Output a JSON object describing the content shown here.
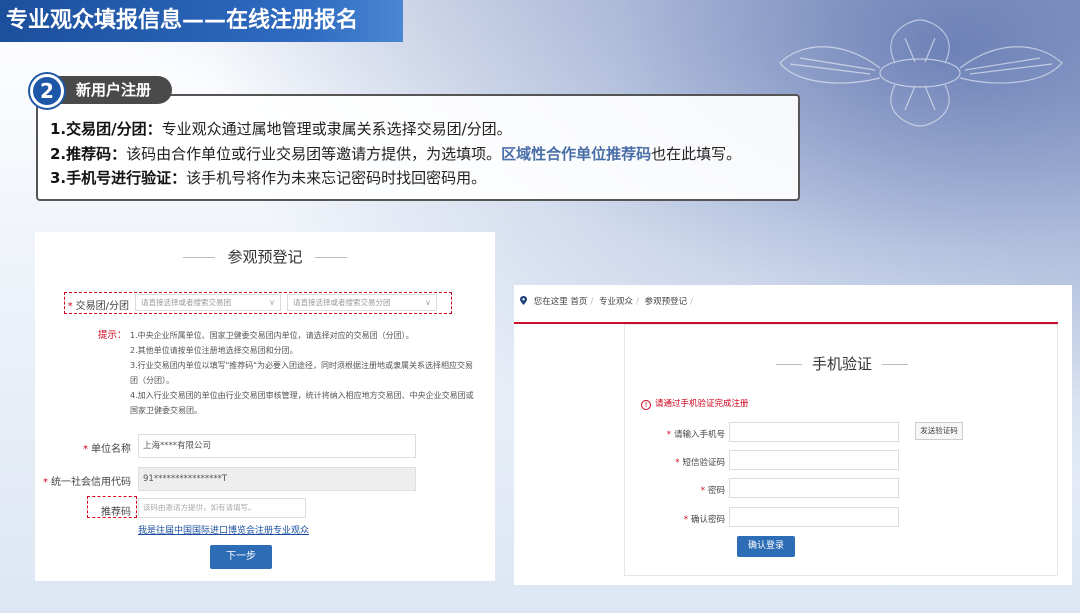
{
  "banner": {
    "title": "专业观众填报信息——在线注册报名"
  },
  "step": {
    "number": "2",
    "title": "新用户注册",
    "lines": [
      {
        "bold": "1.交易团/分团：",
        "text": "专业观众通过属地管理或隶属关系选择交易团/分团。"
      },
      {
        "bold": "2.推荐码：",
        "text": "该码由合作单位或行业交易团等邀请方提供，为选填项。",
        "highlight": "区域性合作单位推荐码",
        "tail": "也在此填写。"
      },
      {
        "bold": "3.手机号进行验证：",
        "text": "该手机号将作为未来忘记密码时找回密码用。"
      }
    ]
  },
  "registration": {
    "title": "参观预登记",
    "group_label": "交易团/分团",
    "group_placeholder": "请直接选择或者搜索交易团",
    "subgroup_placeholder": "请直接选择或者搜索交易分团",
    "tips_label": "提示：",
    "tips": [
      "1.中央企业所属单位、国家卫健委交易团内单位，请选择对应的交易团（分团）。",
      "2.其他单位请按单位注册地选择交易团和分团。",
      "3.行业交易团内单位以填写\"推荐码\"为必要入团途径，同时须根据注册地或隶属关系选择相应交易团（分团）。",
      "4.加入行业交易团的单位由行业交易团审核管理，统计将纳入相应地方交易团、中央企业交易团或国家卫健委交易团。"
    ],
    "company_label": "单位名称",
    "company_value": "上海****有限公司",
    "credit_label": "统一社会信用代码",
    "credit_value": "91****************T",
    "referral_label": "推荐码",
    "referral_placeholder": "该码由邀请方提供，如有请填写。",
    "past_link": "我是往届中国国际进口博览会注册专业观众",
    "next_button": "下一步"
  },
  "verification": {
    "breadcrumb_prefix": "您在这里",
    "breadcrumb": [
      "首页",
      "专业观众",
      "参观预登记"
    ],
    "title": "手机验证",
    "warning": "请通过手机验证完成注册",
    "phone_label": "请输入手机号",
    "sms_button": "发送验证码",
    "sms_label": "短信验证码",
    "password_label": "密码",
    "confirm_password_label": "确认密码",
    "confirm_button": "确认登录"
  },
  "colors": {
    "accent": "#1e56a8",
    "required": "#d0021b",
    "button": "#2d6db5",
    "highlight": "#4a6fa8"
  }
}
